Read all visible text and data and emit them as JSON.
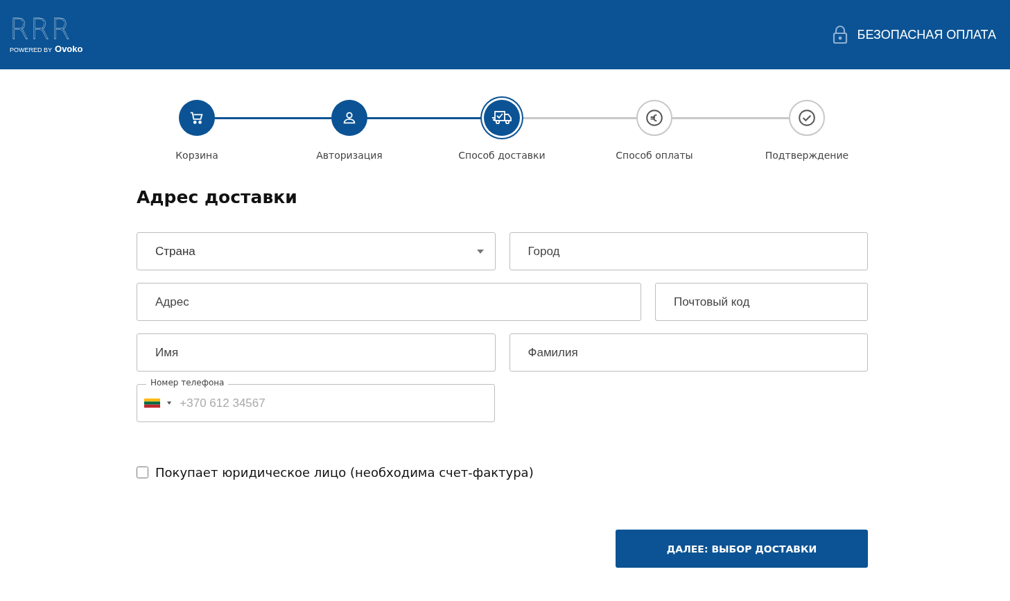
{
  "header": {
    "logo": {
      "mark": "RRR",
      "powered_by": "POWERED BY",
      "brand": "Ovoko"
    },
    "secure_label": "БЕЗОПАСНАЯ ОПЛАТА"
  },
  "steps": [
    {
      "label": "Корзина",
      "done": true,
      "selected": false
    },
    {
      "label": "Авторизация",
      "done": true,
      "selected": false
    },
    {
      "label": "Способ доставки",
      "done": false,
      "selected": true
    },
    {
      "label": "Способ оплаты",
      "done": false,
      "selected": false
    },
    {
      "label": "Подтверждение",
      "done": false,
      "selected": false
    }
  ],
  "form": {
    "title": "Адрес доставки",
    "rows": [
      [
        {
          "kind": "select",
          "placeholder": "Страна"
        },
        {
          "kind": "text",
          "placeholder": "Город"
        }
      ],
      [
        {
          "kind": "text",
          "placeholder": "Адрес"
        },
        {
          "kind": "text",
          "placeholder": "Почтовый код"
        }
      ],
      [
        {
          "kind": "text",
          "placeholder": "Имя"
        },
        {
          "kind": "text",
          "placeholder": "Фамилия"
        }
      ],
      [
        {
          "kind": "phone",
          "label": "Номер телефона",
          "placeholder": "+370 612 34567"
        }
      ]
    ],
    "company_checkbox": {
      "label": "Покупает юридическое лицо (необходима счет-фактура)",
      "checked": false
    },
    "next_button": "ДАЛЕЕ: ВЫБОР ДОСТАВКИ"
  }
}
